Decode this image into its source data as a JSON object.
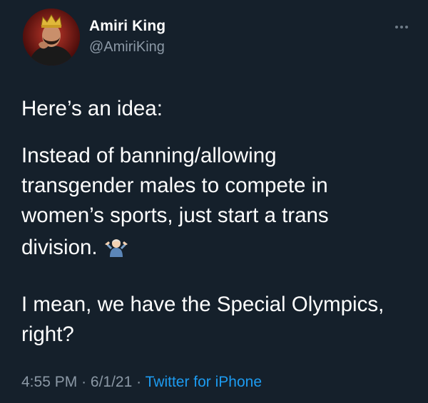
{
  "tweet": {
    "author": {
      "display_name": "Amiri King",
      "handle": "@AmiriKing",
      "avatar_icon": "crowned-man-avatar"
    },
    "more_icon": "ellipsis-icon",
    "body": {
      "line1": "Here’s an idea:",
      "para2_line1": "Instead of banning/allowing",
      "para2_line2": "transgender males to compete in",
      "para2_line3": "women’s sports, just start a trans",
      "para2_line4": "division.",
      "emoji": "person-shrugging-emoji",
      "para3_line1": "I mean, we have the Special Olympics,",
      "para3_line2": "right?"
    },
    "meta": {
      "time": "4:55 PM",
      "separator": "·",
      "date": "6/1/21",
      "source": "Twitter for iPhone"
    }
  },
  "colors": {
    "background": "#15202b",
    "text": "#ffffff",
    "secondary": "#8b98a5",
    "link": "#1d9bf0"
  }
}
